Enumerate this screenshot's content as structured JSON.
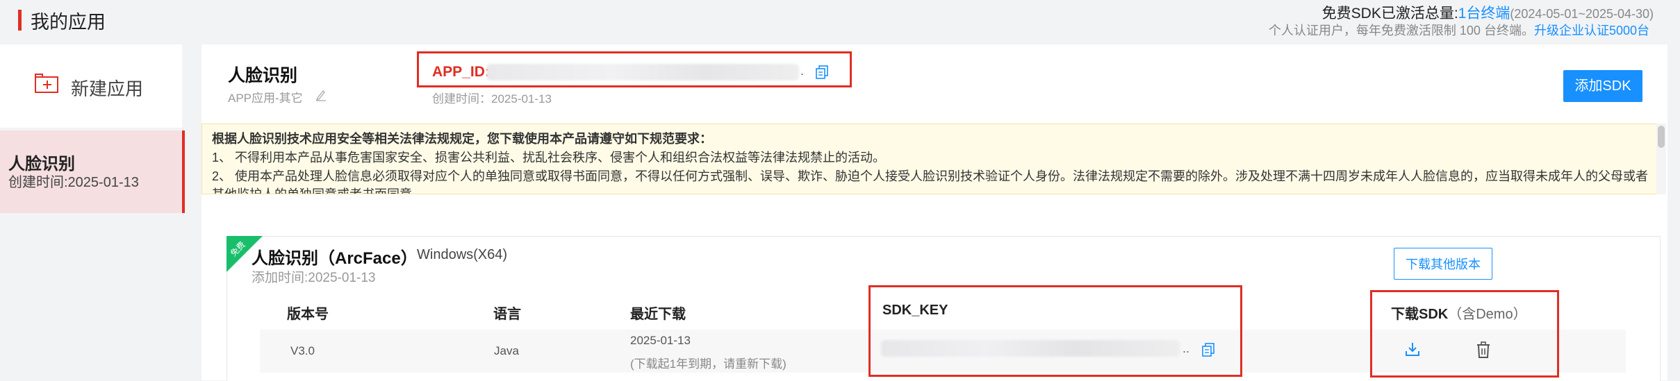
{
  "header": {
    "title": "我的应用",
    "quota_label": "免费SDK已激活总量:",
    "quota_value": "1台终端",
    "quota_period": "(2024-05-01~2025-04-30)",
    "quota_note": "个人认证用户，每年免费激活限制 100 台终端。",
    "upgrade_link": "升级企业认证5000台"
  },
  "sidebar": {
    "new_app_label": "新建应用",
    "items": [
      {
        "name": "人脸识别",
        "created": "创建时间:2025-01-13"
      }
    ]
  },
  "app": {
    "name": "人脸识别",
    "type": "APP应用-其它",
    "app_id_label": "APP_ID:",
    "app_id_suffix": ".",
    "created": "创建时间：2025-01-13",
    "add_sdk_button": "添加SDK"
  },
  "notice": {
    "title": "根据人脸识别技术应用安全等相关法律法规规定，您下载使用本产品请遵守如下规范要求：",
    "line1": "1、 不得利用本产品从事危害国家安全、损害公共利益、扰乱社会秩序、侵害个人和组织合法权益等法律法规禁止的活动。",
    "line2": "2、 使用本产品处理人脸信息必须取得对应个人的单独同意或取得书面同意，不得以任何方式强制、误导、欺诈、胁迫个人接受人脸识别技术验证个人身份。法律法规规定不需要的除外。涉及处理不满十四周岁未成年人人脸信息的，应当取得未成年人的父母或者",
    "line3": "其他监护人的单独同意或者书面同意。"
  },
  "sdk": {
    "badge": "免费",
    "name": "人脸识别（ArcFace）",
    "platform": "Windows(X64)",
    "added": "添加时间:2025-01-13",
    "other_versions_button": "下载其他版本",
    "columns": {
      "version": "版本号",
      "language": "语言",
      "recent_download": "最近下载",
      "sdk_key": "SDK_KEY",
      "download": "下载SDK",
      "download_sub": "（含Demo）"
    },
    "rows": [
      {
        "version": "V3.0",
        "language": "Java",
        "download_date": "2025-01-13",
        "download_note": "(下载起1年到期，请重新下载)",
        "key_suffix": ".."
      }
    ]
  },
  "colors": {
    "accent_red": "#e02e24",
    "primary_blue": "#1890ff",
    "free_badge_green": "#19be6b",
    "notice_bg": "#fffbe7"
  },
  "icons": [
    "copy-icon",
    "edit-icon",
    "download-icon",
    "trash-icon",
    "new-app-icon"
  ]
}
